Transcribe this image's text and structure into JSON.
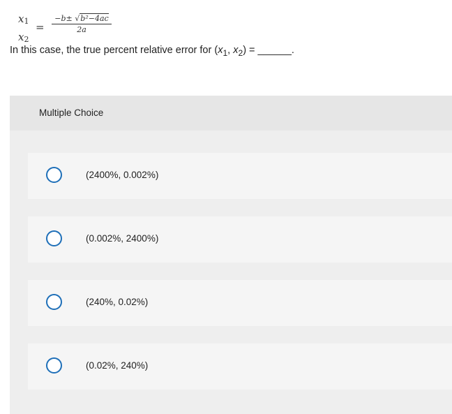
{
  "formula": {
    "lhs_top": "x",
    "lhs_top_sub": "1",
    "lhs_bottom": "x",
    "lhs_bottom_sub": "2",
    "equals": "=",
    "numerator_prefix": "−b±",
    "sqrt_symbol": "√",
    "radicand": "b²−4ac",
    "denominator": "2a"
  },
  "question": {
    "text_before": "In this case, the true percent relative error for (",
    "x1": "x",
    "x1_sub": "1",
    "separator": ", ",
    "x2": "x",
    "x2_sub": "2",
    "text_after": ") = ______."
  },
  "multiple_choice": {
    "title": "Multiple Choice",
    "options": [
      {
        "label": "(2400%, 0.002%)",
        "selected": false
      },
      {
        "label": "(0.002%, 2400%)",
        "selected": false
      },
      {
        "label": "(240%, 0.02%)",
        "selected": false
      },
      {
        "label": "(0.02%, 240%)",
        "selected": false
      }
    ]
  },
  "colors": {
    "radio_border": "#1e6fb8",
    "panel_background": "#eeeeee",
    "option_background": "#f5f5f5"
  }
}
